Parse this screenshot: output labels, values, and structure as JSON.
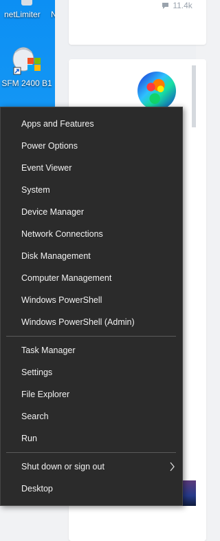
{
  "desktop": {
    "icons": [
      {
        "label": "netLimiter"
      },
      {
        "label": "SFM 2400 B1"
      }
    ],
    "edge_label": "N"
  },
  "webpage": {
    "comment_count": "11.4k"
  },
  "menu": {
    "items": [
      {
        "label": "Apps and Features"
      },
      {
        "label": "Power Options"
      },
      {
        "label": "Event Viewer"
      },
      {
        "label": "System"
      },
      {
        "label": "Device Manager"
      },
      {
        "label": "Network Connections"
      },
      {
        "label": "Disk Management"
      },
      {
        "label": "Computer Management"
      },
      {
        "label": "Windows PowerShell"
      },
      {
        "label": "Windows PowerShell (Admin)"
      },
      {
        "label": "Task Manager"
      },
      {
        "label": "Settings"
      },
      {
        "label": "File Explorer"
      },
      {
        "label": "Search"
      },
      {
        "label": "Run"
      },
      {
        "label": "Shut down or sign out"
      },
      {
        "label": "Desktop"
      }
    ]
  }
}
